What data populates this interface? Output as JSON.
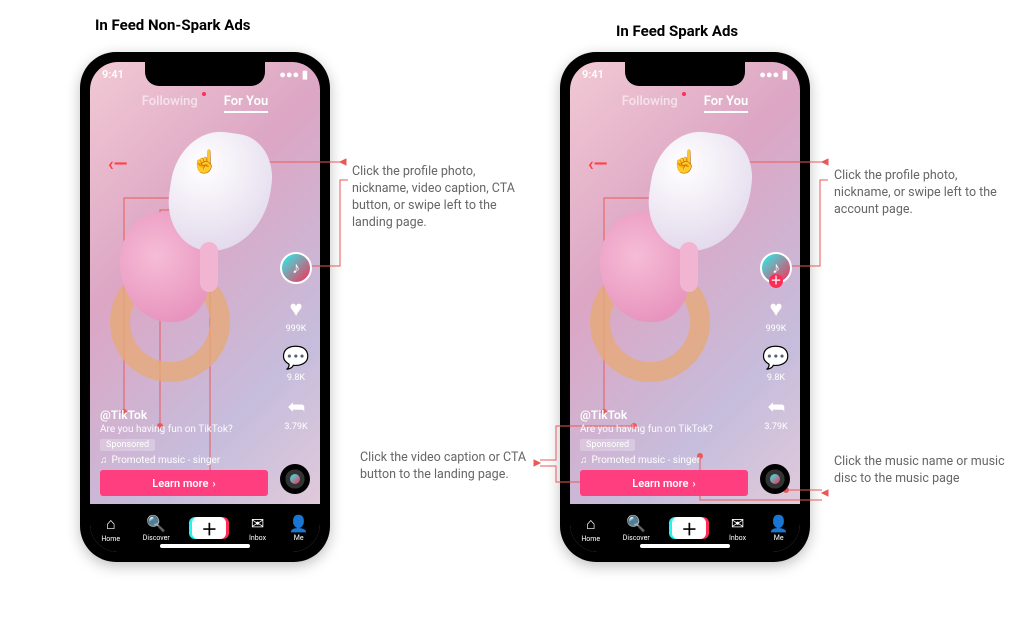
{
  "titles": {
    "left": "In Feed Non-Spark Ads",
    "right": "In Feed Spark Ads"
  },
  "phone": {
    "status_time": "9:41",
    "tabs": {
      "following": "Following",
      "for_you": "For You"
    },
    "nickname": "@TikTok",
    "caption": "Are you having fun on TikTok?",
    "sponsored_label": "Sponsored",
    "music": "Promoted music - singer",
    "cta": "Learn more",
    "cta_arrow": "›",
    "likes": "999K",
    "comments": "9.8K",
    "shares": "3.79K",
    "nav": {
      "home": "Home",
      "discover": "Discover",
      "inbox": "Inbox",
      "me": "Me"
    },
    "spark_has_follow_plus": true
  },
  "annotations": {
    "left_top": "Click the profile photo, nickname, video caption, CTA button, or swipe left to the landing page.",
    "right_top": "Click the profile photo, nickname, or swipe left to the account page.",
    "right_bottom_left": "Click the video caption or CTA button to the landing page.",
    "right_bottom_right": "Click the music name or music disc to the music page"
  }
}
